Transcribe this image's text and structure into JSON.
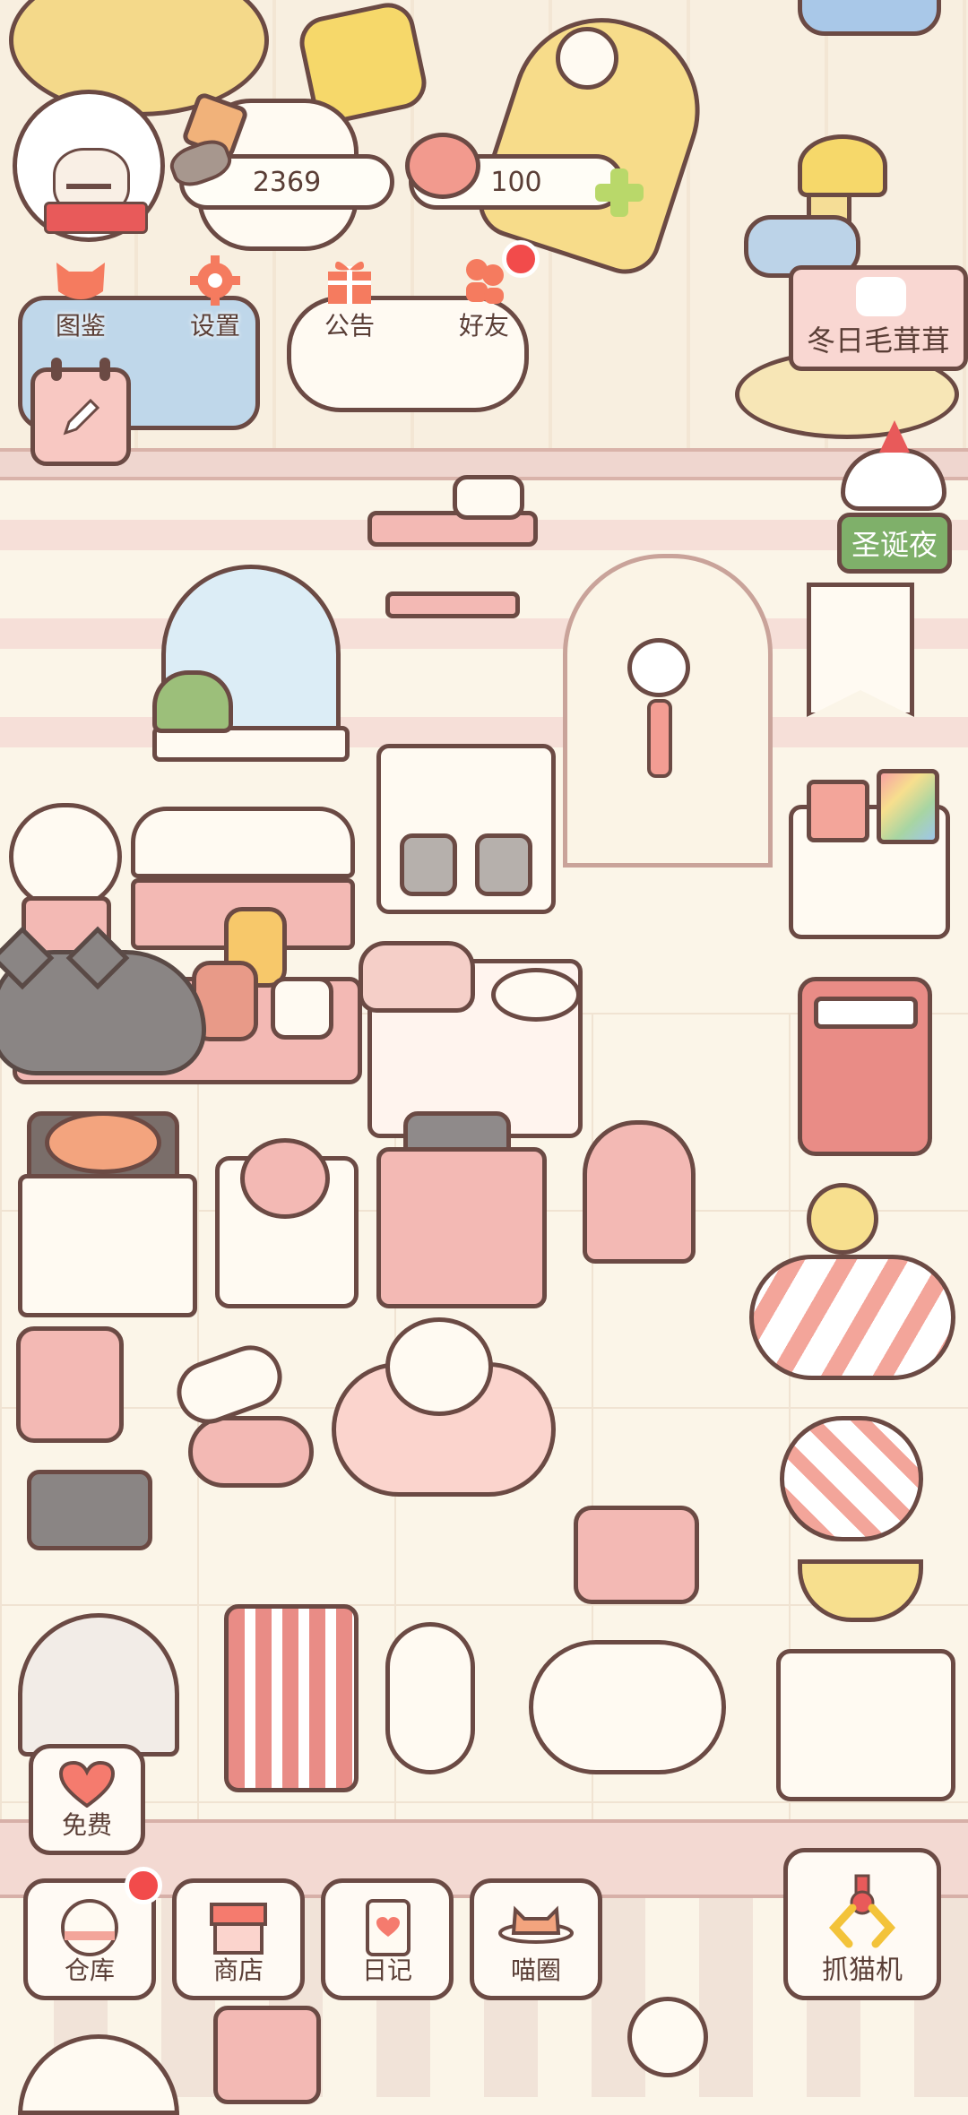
{
  "hud": {
    "coins": "2369",
    "hearts": "100"
  },
  "top_menu": {
    "items": [
      {
        "label": "图鉴",
        "icon": "cat-head-icon"
      },
      {
        "label": "设置",
        "icon": "gear-icon"
      },
      {
        "label": "公告",
        "icon": "gift-icon"
      },
      {
        "label": "好友",
        "icon": "friends-icon",
        "badge": true
      }
    ]
  },
  "events": {
    "winter_label": "冬日毛茸茸",
    "christmas_label": "圣诞夜"
  },
  "free_button": {
    "label": "免费",
    "icon": "heart-icon"
  },
  "bottom_bar": {
    "items": [
      {
        "label": "仓库",
        "icon": "warehouse-icon",
        "badge": true
      },
      {
        "label": "商店",
        "icon": "shop-icon"
      },
      {
        "label": "日记",
        "icon": "diary-icon"
      },
      {
        "label": "喵圈",
        "icon": "planet-cat-icon"
      }
    ],
    "claw_label": "抓猫机"
  },
  "colors": {
    "outline": "#6b4a44",
    "pink": "#f3b9b4",
    "badge_red": "#f24b4b",
    "event_green": "#7fb06a",
    "cream": "#fbf5e8"
  }
}
